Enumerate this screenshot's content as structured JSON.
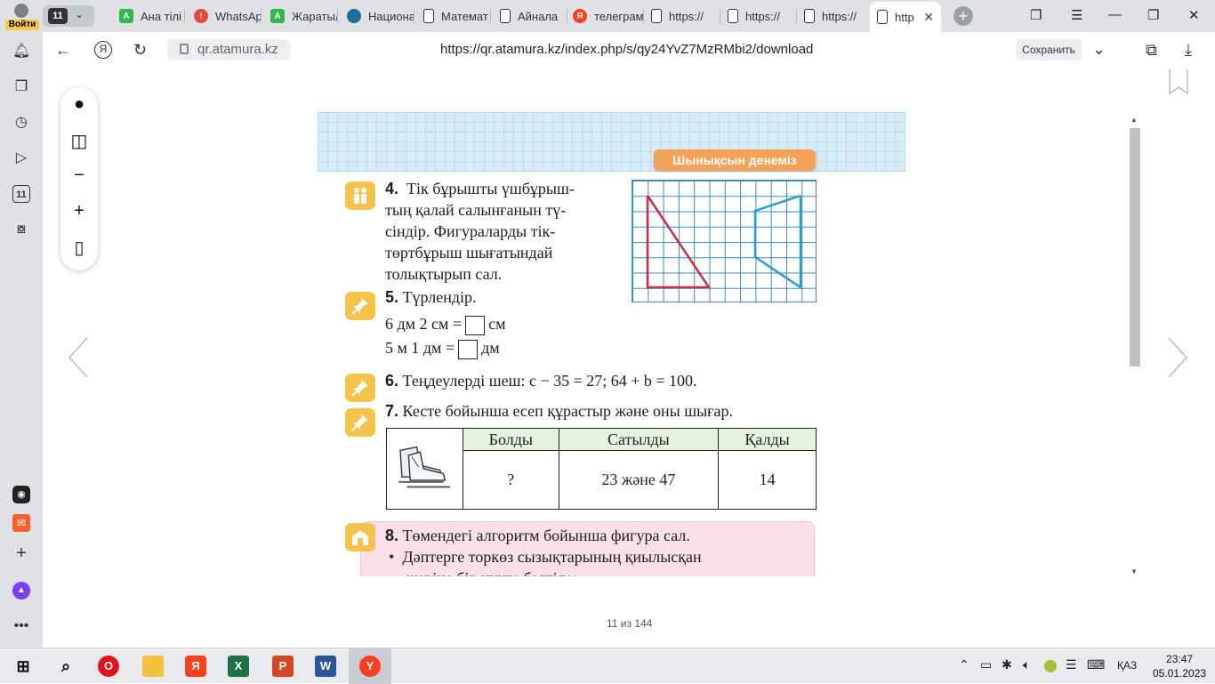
{
  "browser": {
    "profile_label": "Войти",
    "tab_count": "11",
    "tabs": [
      {
        "label": "Ана тілі",
        "icon": "green-a-icon",
        "color": "#2db84d"
      },
      {
        "label": "WhatsApp",
        "icon": "alert-icon",
        "color": "#e8463a"
      },
      {
        "label": "Жаратылыс",
        "icon": "green-a-icon",
        "color": "#2db84d"
      },
      {
        "label": "Национал",
        "icon": "national-icon",
        "color": "#1e6e9e"
      },
      {
        "label": "Математ",
        "icon": "document-icon",
        "color": "#ffffff"
      },
      {
        "label": "Айнала",
        "icon": "document-icon",
        "color": "#ffffff"
      },
      {
        "label": "телеграм",
        "icon": "yandex-icon",
        "color": "#fc3f1d"
      },
      {
        "label": "https://",
        "icon": "document-icon",
        "color": "#ffffff"
      },
      {
        "label": "https://",
        "icon": "document-icon",
        "color": "#ffffff"
      },
      {
        "label": "https://",
        "icon": "document-icon",
        "color": "#ffffff"
      },
      {
        "label": "http",
        "icon": "document-icon",
        "color": "#ffffff",
        "active": true
      }
    ],
    "domain": "qr.atamura.kz",
    "url": "https://qr.atamura.kz/index.php/s/qy24YvZ7MzRMbi2/download",
    "save_label": "Сохранить"
  },
  "pdf": {
    "page_indicator": "11 из 144"
  },
  "textbook": {
    "badge": "Шынықсын денеміз",
    "task4": {
      "num": "4.",
      "lines": [
        "Тік бұрышты үшбұрыш-",
        "тың қалай салынғанын тү-",
        "сіндір. Фигураларды тік-",
        "төртбұрыш шығатындай",
        "толықтырып сал."
      ]
    },
    "task5": {
      "num": "5.",
      "title": "Түрлендір.",
      "line1_left": "6 дм 2 см =",
      "line1_right": "см",
      "line2_left": "5 м 1 дм =",
      "line2_right": "дм"
    },
    "task6": {
      "num": "6.",
      "text": "Теңдеулерді шеш: c − 35 = 27;    64 + b = 100."
    },
    "task7": {
      "num": "7.",
      "text": "Кесте бойынша есеп құрастыр және оны шығар.",
      "headers": [
        "Болды",
        "Сатылды",
        "Қалды"
      ],
      "row": [
        "?",
        "23 және 47",
        "14"
      ]
    },
    "task8": {
      "num": "8.",
      "text": "Төмендегі алгоритм бойынша фигура сал.",
      "bullet": "Дәптерге торкөз сызықтарының қиылысқан",
      "bullet2": "жеріне бір нүкте белгіле:"
    }
  },
  "taskbar": {
    "time": "23:47",
    "date": "05.01.2023",
    "lang": "ҚАЗ"
  }
}
